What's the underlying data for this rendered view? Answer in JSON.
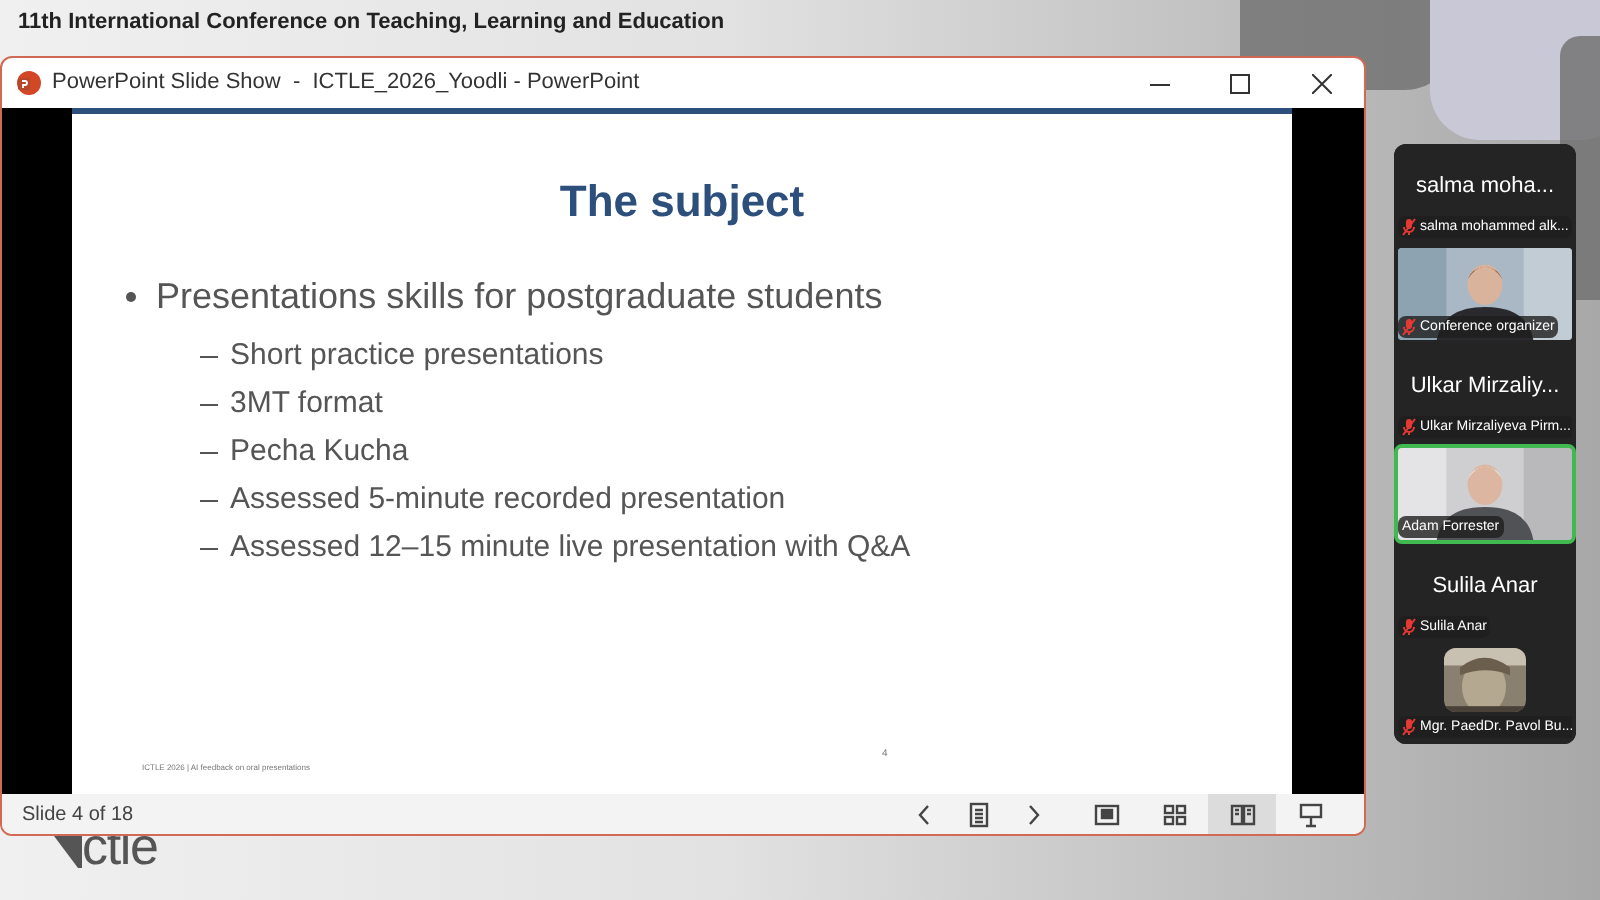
{
  "banner": {
    "title": "11th International Conference on Teaching, Learning and Education",
    "logo_text": "ctle"
  },
  "window": {
    "title": "PowerPoint Slide Show  -  ICTLE_2026_Yoodli - PowerPoint"
  },
  "slide": {
    "title": "The subject",
    "bullets": [
      {
        "text": "Presentations skills for postgraduate students",
        "children": [
          {
            "text": "Short practice presentations"
          },
          {
            "text": "3MT format"
          },
          {
            "text": "Pecha Kucha"
          },
          {
            "text": "Assessed 5-minute recorded presentation"
          },
          {
            "text": "Assessed 12–15 minute live presentation with Q&A"
          }
        ]
      }
    ],
    "footer": "ICTLE 2026 | AI feedback on oral presentations",
    "number": "4"
  },
  "status_bar": {
    "slide_count": "Slide 4 of 18",
    "tools": [
      {
        "kind": "prev",
        "selected": false
      },
      {
        "kind": "notes",
        "selected": false
      },
      {
        "kind": "next",
        "selected": false
      },
      {
        "kind": "normal",
        "selected": false
      },
      {
        "kind": "sorter",
        "selected": false
      },
      {
        "kind": "reading",
        "selected": true
      },
      {
        "kind": "slideshow",
        "selected": false
      }
    ]
  },
  "participants": [
    {
      "kind": "name",
      "display": "salma moha...",
      "label": "salma mohammed alk...",
      "muted": true,
      "speaking": false
    },
    {
      "kind": "video",
      "label": "Conference organizer",
      "muted": true,
      "speaking": false
    },
    {
      "kind": "name",
      "display": "Ulkar Mirzaliy...",
      "label": "Ulkar Mirzaliyeva Pirm...",
      "muted": true,
      "speaking": false
    },
    {
      "kind": "video",
      "label": "Adam Forrester",
      "muted": false,
      "speaking": true
    },
    {
      "kind": "name",
      "display": "Sulila Anar",
      "label": "Sulila Anar",
      "muted": true,
      "speaking": false
    },
    {
      "kind": "avatar",
      "label": "Mgr. PaedDr. Pavol Bu...",
      "muted": true,
      "speaking": false
    }
  ]
}
